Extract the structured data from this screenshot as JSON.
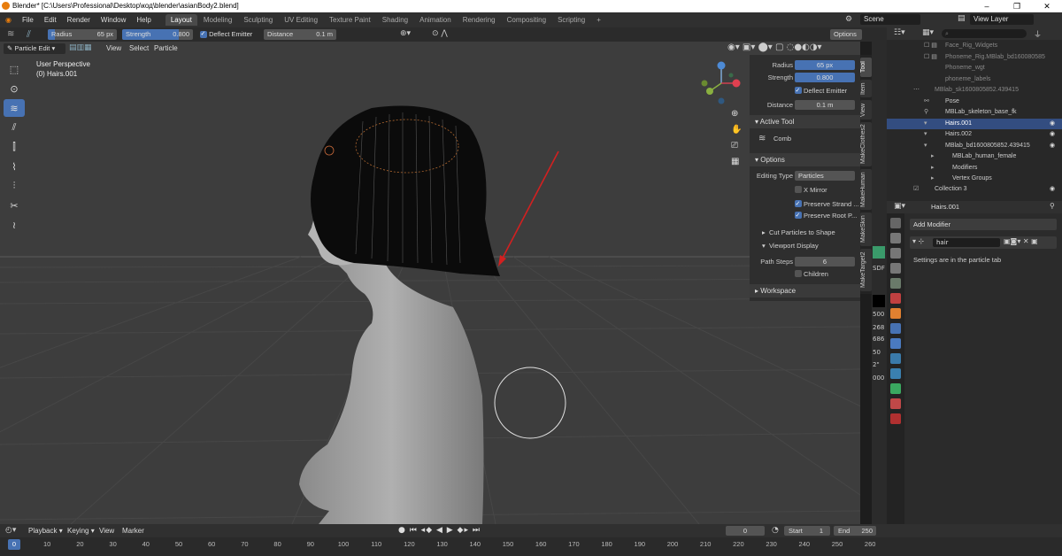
{
  "window": {
    "title": "Blender* [C:\\Users\\Professional\\Desktop\\код\\blender\\asianBody2.blend]",
    "controls": [
      "–",
      "❐",
      "✕"
    ]
  },
  "topbar": {
    "menus": [
      "File",
      "Edit",
      "Render",
      "Window",
      "Help"
    ],
    "workspaces": [
      "Layout",
      "Modeling",
      "Sculpting",
      "UV Editing",
      "Texture Paint",
      "Shading",
      "Animation",
      "Rendering",
      "Compositing",
      "Scripting"
    ],
    "add_tab": "+",
    "scene": "Scene",
    "view_layer": "View Layer"
  },
  "toolheader": {
    "radius_label": "Radius",
    "radius_value": "65 px",
    "strength_label": "Strength",
    "strength_value": "0.800",
    "deflect_label": "Deflect Emitter",
    "distance_label": "Distance",
    "distance_value": "0.1 m",
    "options_label": "Options"
  },
  "viewport_header": {
    "mode": "Particle Edit",
    "menus": [
      "View",
      "Select",
      "Particle"
    ]
  },
  "viewport": {
    "perspective_label": "User Perspective",
    "object_label": "(0) Hairs.001",
    "side_values": [
      "500",
      "268",
      "686",
      "50",
      "2\"",
      "000"
    ],
    "side_label": "SDF"
  },
  "npanel": {
    "radius_label": "Radius",
    "radius_value": "65 px",
    "strength_label": "Strength",
    "strength_value": "0.800",
    "deflect_label": "Deflect Emitter",
    "distance_label": "Distance",
    "distance_value": "0.1 m",
    "active_tool_header": "Active Tool",
    "active_tool_name": "Comb",
    "options_header": "Options",
    "editing_type_label": "Editing Type",
    "editing_type_value": "Particles",
    "x_mirror": "X Mirror",
    "preserve_strand": "Preserve Strand ...",
    "preserve_root": "Preserve Root P...",
    "cut_particles": "Cut Particles to Shape",
    "viewport_display": "Viewport Display",
    "path_steps_label": "Path Steps",
    "path_steps_value": "6",
    "children_label": "Children",
    "workspace_header": "Workspace"
  },
  "vtabs": [
    "Tool",
    "Item",
    "View",
    "MakeClothes2",
    "MakeHuman",
    "MakeSkin",
    "MakeTarget2"
  ],
  "outliner": {
    "search_placeholder": "",
    "rows": [
      {
        "label": "Face_Rig_Widgets",
        "style": "dim"
      },
      {
        "label": "Phoneme_Rig.MBlab_bd160080585",
        "style": "dim"
      },
      {
        "label": "Phoneme_wgt",
        "style": "dim"
      },
      {
        "label": "phoneme_labels",
        "style": "dim"
      },
      {
        "label": "MBlab_sk1600805852.439415",
        "style": "dim"
      },
      {
        "label": "Pose",
        "style": ""
      },
      {
        "label": "MBLab_skeleton_base_fk",
        "style": ""
      },
      {
        "label": "Hairs.001",
        "style": "sel"
      },
      {
        "label": "Hairs.002",
        "style": ""
      },
      {
        "label": "MBlab_bd1600805852.439415",
        "style": ""
      },
      {
        "label": "MBLab_human_female",
        "style": ""
      },
      {
        "label": "Modifiers",
        "style": ""
      },
      {
        "label": "Vertex Groups",
        "style": ""
      },
      {
        "label": "Collection 3",
        "style": ""
      }
    ]
  },
  "properties": {
    "object_name": "Hairs.001",
    "add_modifier": "Add Modifier",
    "modifier_name": "hair",
    "info_text": "Settings are in the particle tab"
  },
  "timeline": {
    "playback": "Playback",
    "keying": "Keying",
    "view": "View",
    "marker": "Marker",
    "current_frame": "0",
    "start_label": "Start",
    "start_value": "1",
    "end_label": "End",
    "end_value": "250",
    "ticks": [
      "0",
      "10",
      "20",
      "30",
      "40",
      "50",
      "60",
      "70",
      "80",
      "90",
      "100",
      "110",
      "120",
      "130",
      "140",
      "150",
      "160",
      "170",
      "180",
      "190",
      "200",
      "210",
      "220",
      "230",
      "240",
      "250",
      "260"
    ]
  },
  "colors": {
    "accent_blue": "#4772b3",
    "selected_row": "#334d80",
    "annotation_arrow": "#d22020",
    "orange_blender": "#e87d0d"
  }
}
